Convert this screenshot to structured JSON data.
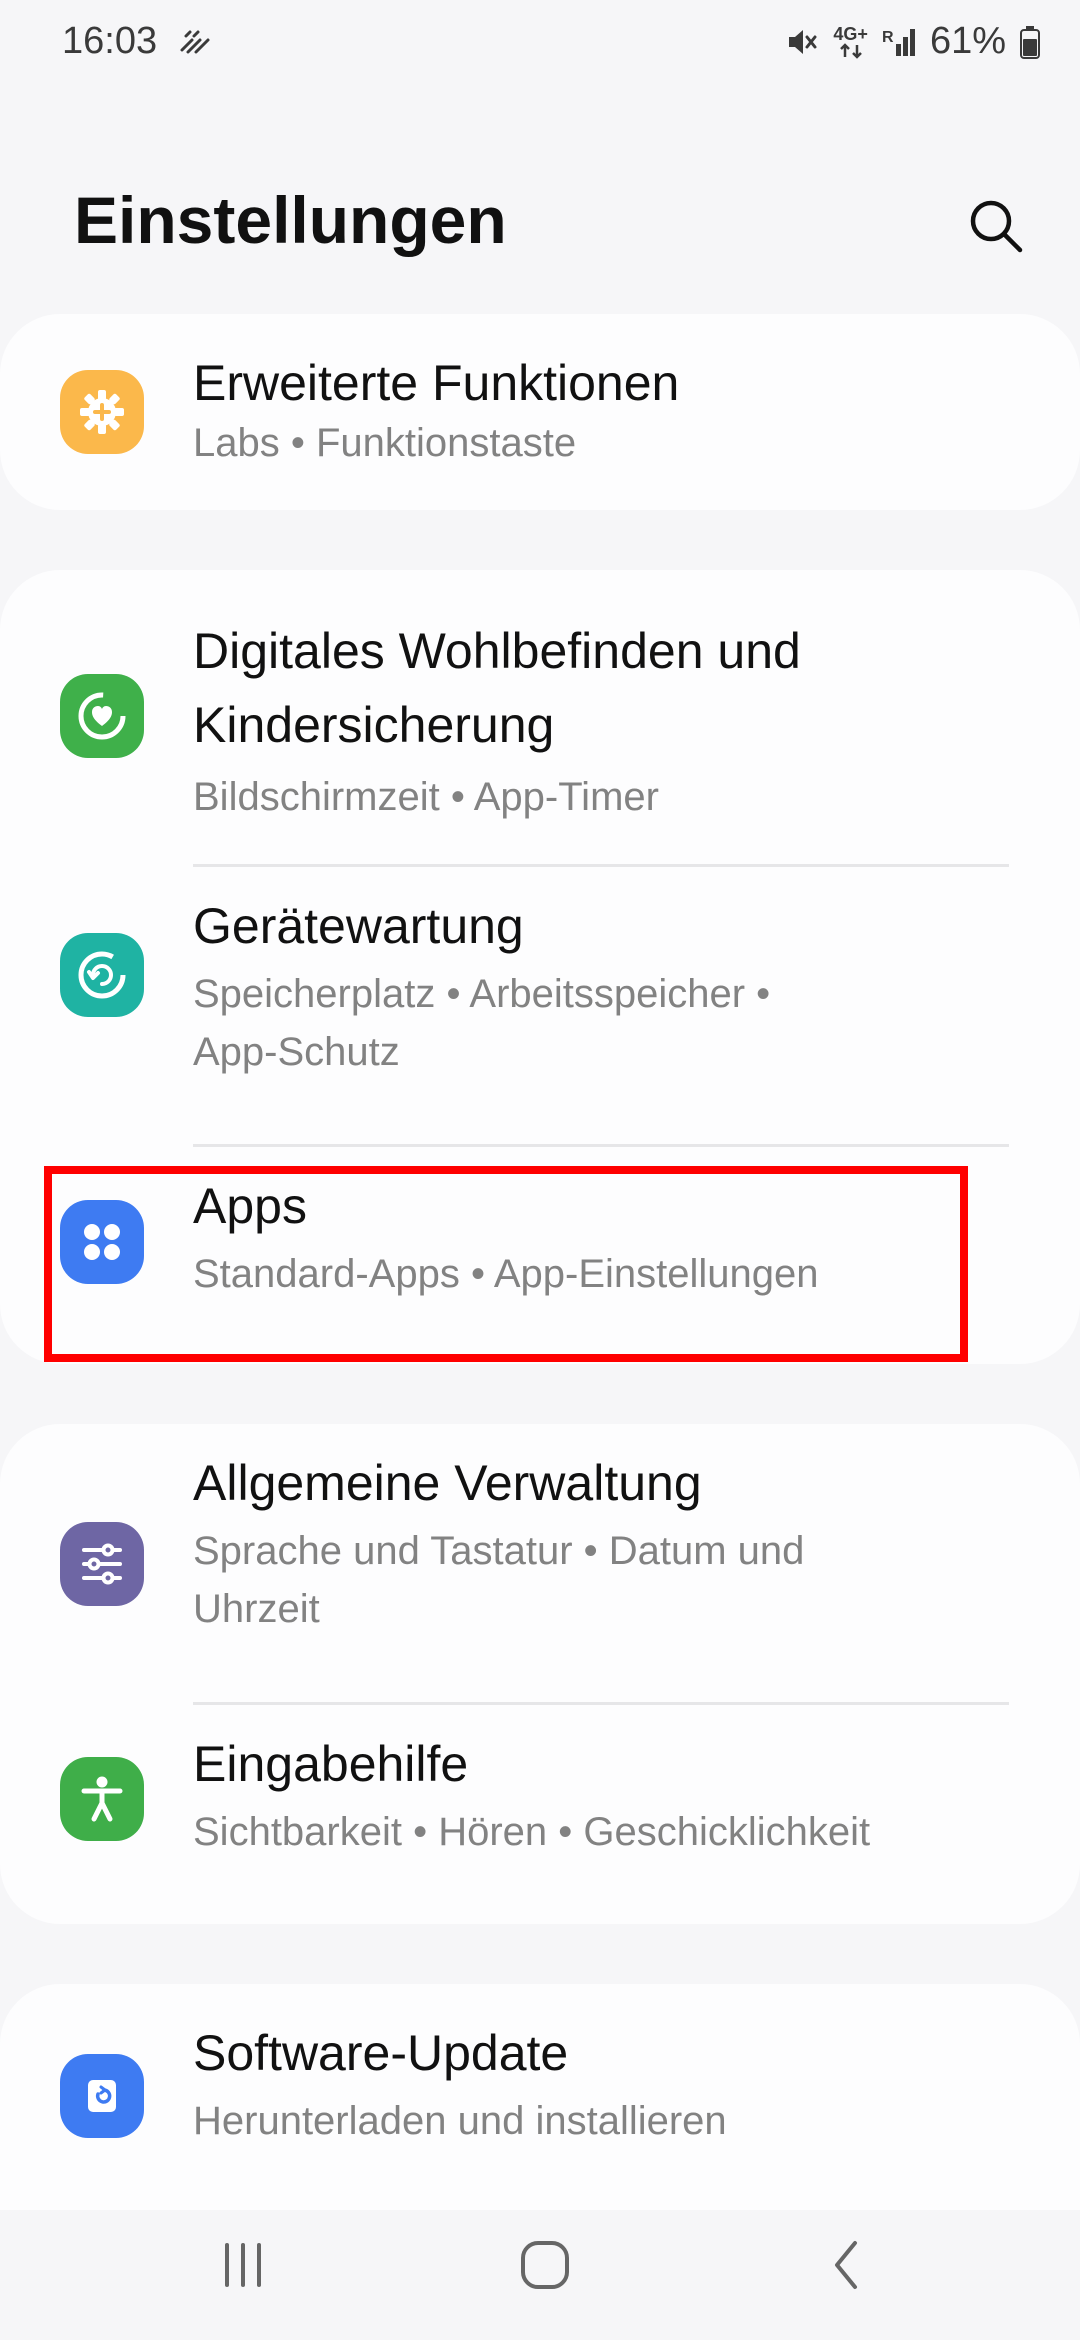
{
  "status_bar": {
    "time": "16:03",
    "network": "4G+",
    "signal_label": "R",
    "battery": "61%"
  },
  "header": {
    "title": "Einstellungen"
  },
  "settings": {
    "advanced": {
      "title": "Erweiterte Funktionen",
      "subtitle": "Labs  •  Funktionstaste",
      "icon": "puzzle-gear-icon",
      "color": "#fbb84b"
    },
    "wellbeing": {
      "title_line1": "Digitales Wohlbefinden und",
      "title_line2": "Kindersicherung",
      "subtitle": "Bildschirmzeit  •  App-Timer",
      "icon": "heart-ring-icon",
      "color": "#3fb04a"
    },
    "care": {
      "title": "Gerätewartung",
      "subtitle_line1": "Speicherplatz  •  Arbeitsspeicher  •",
      "subtitle_line2": "App-Schutz",
      "icon": "device-care-icon",
      "color": "#1fb3a3"
    },
    "apps": {
      "title": "Apps",
      "subtitle": "Standard-Apps  •  App-Einstellungen",
      "icon": "apps-grid-icon",
      "color": "#3e7bf2"
    },
    "general": {
      "title": "Allgemeine Verwaltung",
      "subtitle_line1": "Sprache und Tastatur  •  Datum und",
      "subtitle_line2": "Uhrzeit",
      "icon": "sliders-icon",
      "color": "#6e66a4"
    },
    "accessibility": {
      "title": "Eingabehilfe",
      "subtitle": "Sichtbarkeit  •  Hören  •  Geschicklichkeit",
      "icon": "accessibility-person-icon",
      "color": "#3fae49"
    },
    "software": {
      "title": "Software-Update",
      "subtitle": "Herunterladen und installieren",
      "icon": "update-icon",
      "color": "#3e7bf2"
    }
  },
  "colors": {
    "background": "#f6f6f8",
    "card": "#fdfdfe",
    "highlight": "#ff0000"
  }
}
